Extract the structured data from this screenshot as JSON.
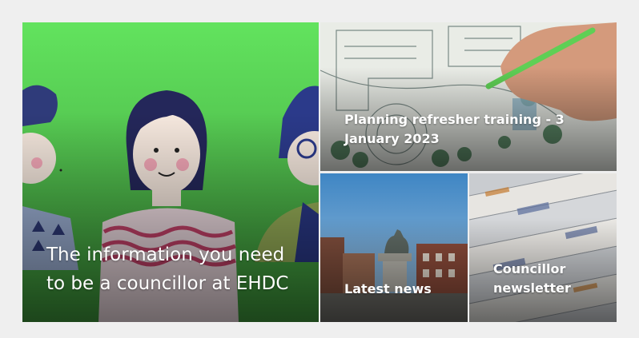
{
  "tiles": [
    {
      "caption": "The information you need to be a councillor at EHDC",
      "image": "councillors-illustration"
    },
    {
      "caption": "Planning refresher training - 3 January 2023",
      "image": "architect-plan-drawing"
    },
    {
      "caption": "Latest news",
      "image": "town-square-statue"
    },
    {
      "caption": "Councillor newsletter",
      "image": "rolled-newspapers"
    }
  ],
  "colors": {
    "background": "#efefef",
    "green_top": "#5fe05c",
    "green_bottom": "#2f6f2e"
  }
}
